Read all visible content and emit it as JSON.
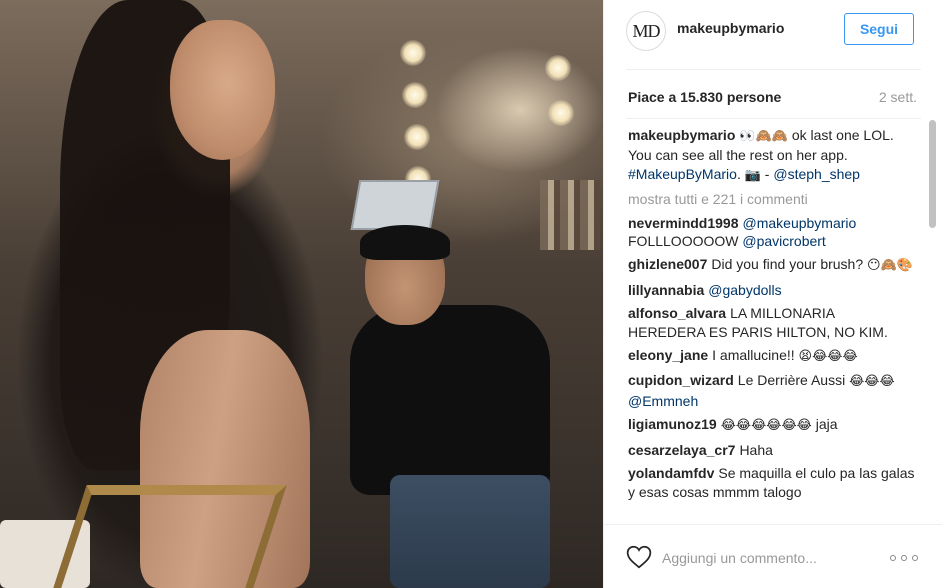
{
  "post": {
    "username": "makeupbymario",
    "avatar_text": "MD",
    "follow_label": "Segui",
    "likes": "Piace a 15.830 persone",
    "time": "2 sett.",
    "caption": {
      "user": "makeupbymario",
      "text_before_emoji": " ",
      "emoji": "👀🙈🙈",
      "text": " ok last one LOL. You can see all the rest on her app. ",
      "hashtag": "#MakeupByMario",
      "text_mid": ". ",
      "emoji2": "📷",
      "text_after": " - ",
      "mention": "@steph_shep"
    },
    "show_more": "mostra tutti e 221 i commenti",
    "comments": [
      {
        "user": "nevermindd1998",
        "parts": [
          {
            "type": "mention",
            "text": "@makeupbymario"
          },
          {
            "type": "text",
            "text": " FOLLLOOOOOW "
          },
          {
            "type": "mention",
            "text": "@pavicrobert"
          }
        ]
      },
      {
        "user": "ghizlene007",
        "parts": [
          {
            "type": "text",
            "text": "Did you find your brush? "
          },
          {
            "type": "emoji",
            "text": "😶🙈🎨"
          }
        ]
      },
      {
        "user": "lillyannabia",
        "parts": [
          {
            "type": "mention",
            "text": "@gabydolls"
          }
        ]
      },
      {
        "user": "alfonso_alvara",
        "parts": [
          {
            "type": "text",
            "text": "LA MILLONARIA HEREDERA ES PARIS HILTON, NO KIM."
          }
        ]
      },
      {
        "user": "eleony_jane",
        "parts": [
          {
            "type": "text",
            "text": "I amallucine!! "
          },
          {
            "type": "emoji",
            "text": "😫😂😂😂"
          }
        ]
      },
      {
        "user": "cupidon_wizard",
        "parts": [
          {
            "type": "text",
            "text": "Le Derrière Aussi "
          },
          {
            "type": "emoji",
            "text": "😂😂😂"
          },
          {
            "type": "text",
            "text": " "
          },
          {
            "type": "mention",
            "text": "@Emmneh"
          }
        ]
      },
      {
        "user": "ligiamunoz19",
        "parts": [
          {
            "type": "emoji",
            "text": "😂😂😂😂😂😂"
          },
          {
            "type": "text",
            "text": " jaja"
          }
        ]
      },
      {
        "user": "cesarzelaya_cr7",
        "parts": [
          {
            "type": "text",
            "text": "Haha"
          }
        ]
      },
      {
        "user": "yolandamfdv",
        "parts": [
          {
            "type": "text",
            "text": "Se maquilla el culo pa las galas y esas cosas mmmm talogo"
          }
        ]
      }
    ],
    "comment_placeholder": "Aggiungi un commento..."
  },
  "icons": {
    "like": "heart-icon",
    "more": "more-options-icon"
  },
  "colors": {
    "accent": "#3897f0",
    "mention": "#003569",
    "muted": "#999999"
  }
}
